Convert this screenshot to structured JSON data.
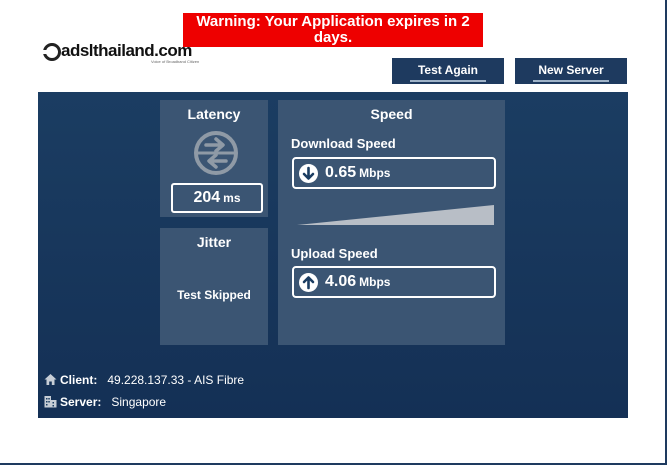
{
  "warning": {
    "text": "Warning: Your Application expires in 2 days."
  },
  "logo": {
    "text": "adslthailand.com",
    "tagline": "Voice of Broadband Citizen"
  },
  "buttons": {
    "test_again": "Test Again",
    "new_server": "New Server"
  },
  "latency": {
    "title": "Latency",
    "value": "204",
    "unit": "ms",
    "icon": "latency-arrows-icon"
  },
  "jitter": {
    "title": "Jitter",
    "status": "Test Skipped"
  },
  "speed": {
    "title": "Speed",
    "download": {
      "label": "Download Speed",
      "value": "0.65",
      "unit": "Mbps",
      "icon": "download-arrow-icon"
    },
    "upload": {
      "label": "Upload Speed",
      "value": "4.06",
      "unit": "Mbps",
      "icon": "upload-arrow-icon"
    }
  },
  "info": {
    "client": {
      "label": "Client:",
      "value": "49.228.137.33 - AIS Fibre",
      "icon": "home-icon"
    },
    "server": {
      "label": "Server:",
      "value": "Singapore",
      "icon": "building-icon"
    }
  },
  "colors": {
    "warning_bg": "#ee0000",
    "button_bg": "#1e3a5f",
    "panel_bg": "#1b3d62",
    "card_bg": "#3b5573",
    "text": "#ffffff"
  }
}
